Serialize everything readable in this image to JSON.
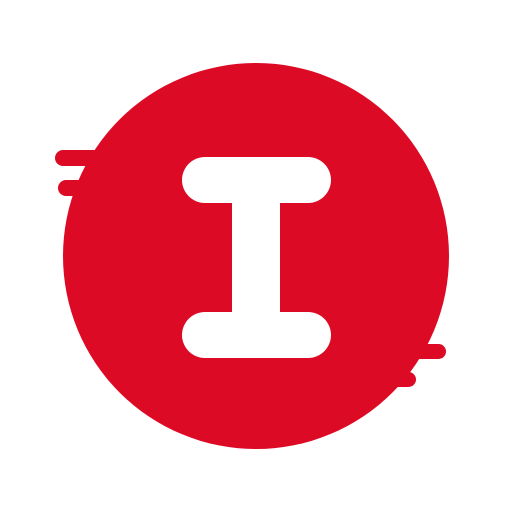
{
  "app_icon": {
    "name": "I-logo-icon",
    "letter": "I",
    "colors": {
      "background": "#ffffff",
      "brand_red": "#dc0a24",
      "glyph": "#ffffff"
    }
  }
}
